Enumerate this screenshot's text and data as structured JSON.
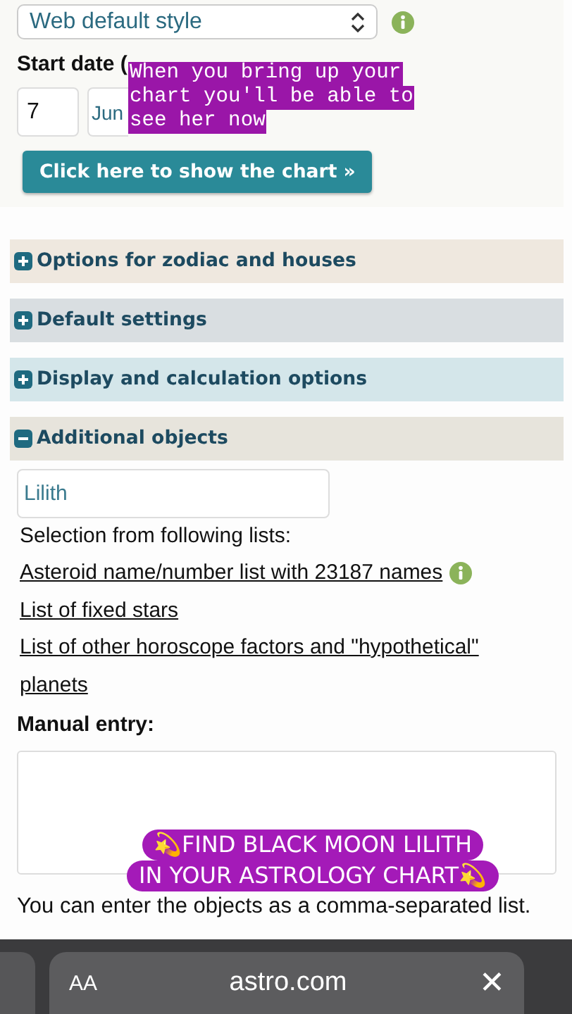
{
  "style_select": {
    "value": "Web default style"
  },
  "start_date": {
    "label": "Start date (",
    "day": "7",
    "month": "Jun"
  },
  "show_chart_button": "Click here to show the chart »",
  "sections": [
    {
      "title": "Options for zodiac and houses",
      "expanded": false,
      "color": "#efe8df"
    },
    {
      "title": "Default settings",
      "expanded": false,
      "color": "#d9dee1"
    },
    {
      "title": "Display and calculation options",
      "expanded": false,
      "color": "#d4e6ea"
    },
    {
      "title": "Additional objects",
      "expanded": true,
      "color": "#e7e4dc"
    }
  ],
  "objects_field": {
    "value": "Lilith"
  },
  "lists_label": "Selection from following lists:",
  "list_links": [
    {
      "text": "Asteroid name/number list with 23187 names",
      "info": true
    },
    {
      "text": "List of fixed stars",
      "info": false
    },
    {
      "text": "List of other horoscope factors and \"hypothetical\" planets",
      "info": false
    }
  ],
  "manual_entry_label": "Manual entry:",
  "hint": "You can enter the objects as a comma-separated list.",
  "captions": [
    {
      "kind": "typewriter",
      "lines": [
        "When you bring up your",
        "chart you'll be able to",
        "see her now"
      ]
    },
    {
      "kind": "pill",
      "lines": [
        "💫FIND BLACK MOON LILITH",
        "IN YOUR ASTROLOGY CHART💫"
      ]
    }
  ],
  "browser_bar": {
    "text_size": "AA",
    "url": "astro.com",
    "close": "✕"
  }
}
